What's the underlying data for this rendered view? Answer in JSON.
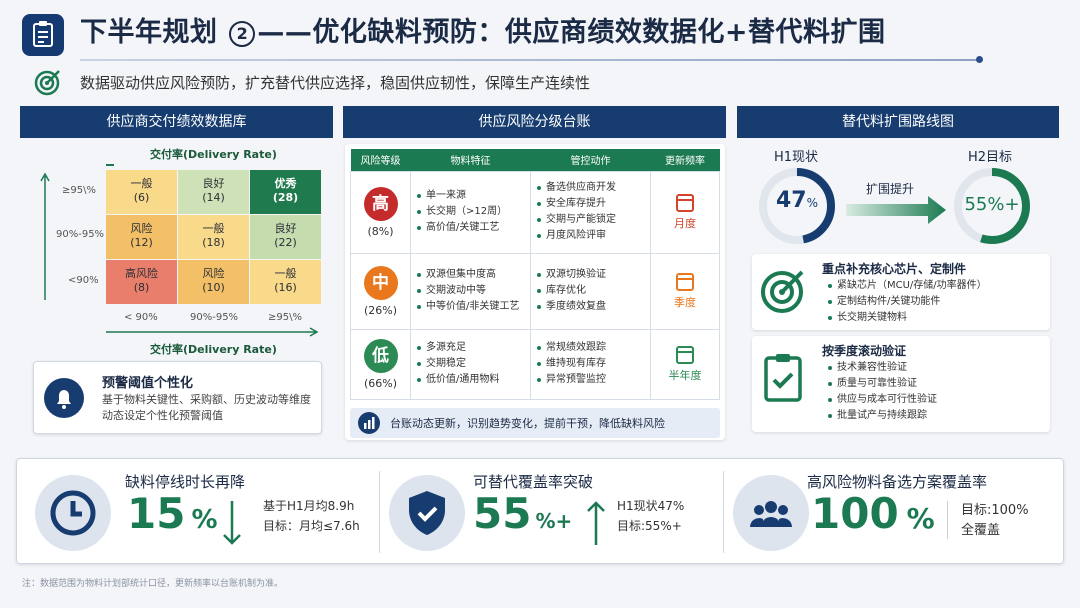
{
  "header": {
    "title": "下半年规划",
    "step": "2",
    "title_rest": "——优化缺料预防：供应商绩效数据化+替代料扩围",
    "subtitle": "数据驱动供应风险预防，扩充替代供应选择，稳固供应韧性，保障生产连续性"
  },
  "supplier_panel": {
    "heading": "供应商交付绩效数据库",
    "top_axis": "交付率(Delivery Rate)",
    "bottom_axis": "交付率(Delivery Rate)",
    "row_labels": [
      "≥95\\%",
      "90%-95%",
      "<90%"
    ],
    "col_labels": [
      "< 90%",
      "90%-95%",
      "≥95\\%"
    ],
    "cells": [
      [
        {
          "label": "一般",
          "count": "(6)"
        },
        {
          "label": "良好",
          "count": "(14)"
        },
        {
          "label": "优秀",
          "count": "(28)"
        }
      ],
      [
        {
          "label": "风险",
          "count": "(12)"
        },
        {
          "label": "一般",
          "count": "(18)"
        },
        {
          "label": "良好",
          "count": "(22)"
        }
      ],
      [
        {
          "label": "高风险",
          "count": "(8)"
        },
        {
          "label": "风险",
          "count": "(10)"
        },
        {
          "label": "一般",
          "count": "(16)"
        }
      ]
    ],
    "alert_title": "预警阈值个性化",
    "alert_text": "基于物料关键性、采购额、历史波动等维度动态设定个性化预警阈值"
  },
  "risk_panel": {
    "heading": "供应风险分级台账",
    "columns": [
      "风险等级",
      "物料特征",
      "管控动作",
      "更新频率"
    ],
    "rows": [
      {
        "level": "高",
        "pct": "(8%)",
        "color": "#c42b2b",
        "features": [
          "单一来源",
          "长交期（>12周）",
          "高价值/关键工艺"
        ],
        "actions": [
          "备选供应商开发",
          "安全库存提升",
          "交期与产能锁定",
          "月度风险评审"
        ],
        "freq": "月度",
        "freq_color": "#d2452b"
      },
      {
        "level": "中",
        "pct": "(26%)",
        "color": "#e8771e",
        "features": [
          "双源但集中度高",
          "交期波动中等",
          "中等价值/非关键工艺"
        ],
        "actions": [
          "双源切换验证",
          "库存优化",
          "季度绩效复盘"
        ],
        "freq": "季度",
        "freq_color": "#e8771e"
      },
      {
        "level": "低",
        "pct": "(66%)",
        "color": "#2c8a55",
        "features": [
          "多源充足",
          "交期稳定",
          "低价值/通用物料"
        ],
        "actions": [
          "常规绩效跟踪",
          "维持现有库存",
          "异常预警监控"
        ],
        "freq": "半年度",
        "freq_color": "#2c8a55"
      }
    ],
    "footer": "台账动态更新，识别趋势变化，提前干预，降低缺料风险"
  },
  "roadmap_panel": {
    "heading": "替代料扩围路线图",
    "h1_label": "H1现状",
    "h1_value": "47",
    "h1_unit": "%",
    "h1_fill": 0.47,
    "arrow_label": "扩围提升",
    "h2_label": "H2目标",
    "h2_value": "55%+",
    "h2_fill": 0.55,
    "item1_title": "重点补充核心芯片、定制件",
    "item1_points": [
      "紧缺芯片（MCU/存储/功率器件）",
      "定制结构件/关键功能件",
      "长交期关键物料"
    ],
    "item2_title": "按季度滚动验证",
    "item2_points": [
      "技术兼容性验证",
      "质量与可靠性验证",
      "供应与成本可行性验证",
      "批量试产与持续跟踪"
    ]
  },
  "kpis": [
    {
      "title": "缺料停线时长再降",
      "value": "15",
      "unit": "%",
      "note1": "基于H1月均8.9h",
      "note2": "目标：月均≤7.6h"
    },
    {
      "title": "可替代覆盖率突破",
      "value": "55",
      "unit": "%+",
      "note1": "H1现状47%",
      "note2": "目标:55%+"
    },
    {
      "title": "高风险物料备选方案覆盖率",
      "value": "100",
      "unit": "%",
      "note1": "目标:100%",
      "note2": "全覆盖"
    }
  ],
  "footnote": "注：数据范围为物料计划部统计口径，更新频率以台账机制为准。",
  "colors": {
    "navy": "#163c70",
    "green": "#1c7a52",
    "red": "#c42b2b",
    "orange": "#e8771e"
  }
}
